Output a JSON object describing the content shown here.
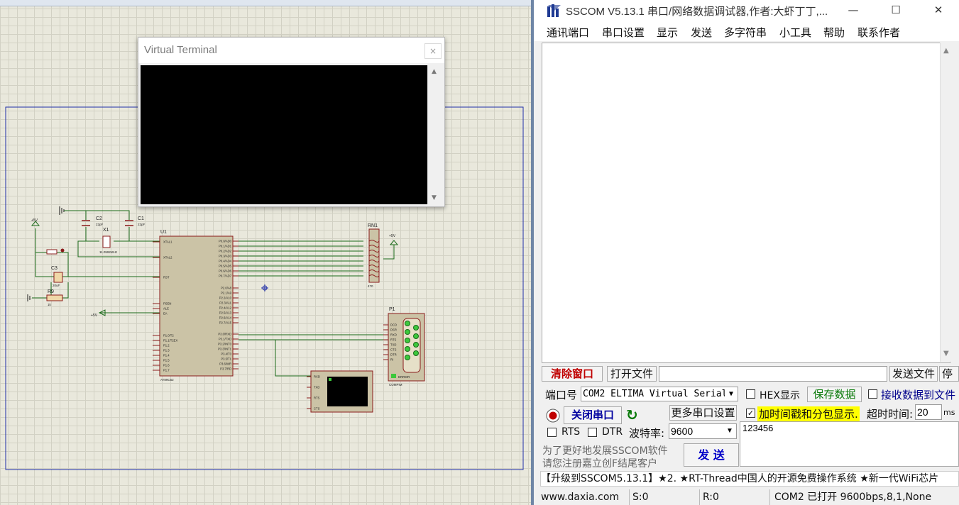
{
  "virtual_terminal": {
    "title": "Virtual Terminal",
    "close": "×"
  },
  "schematic": {
    "components": {
      "c2": "C2",
      "c2_value": "22pF",
      "c1": "C1",
      "c1_value": "22pF",
      "x1": "X1",
      "x1_value": "11.0592MHz",
      "c3": "C3",
      "c3_value": "20uF",
      "r9": "R9",
      "r9_value": "1k",
      "u1": "U1",
      "u1_part": "AT89C52",
      "rn1": "RN1",
      "rn1_value": "470",
      "p1": "P1",
      "p1_part": "COMPIM",
      "p1_error": "ERROR",
      "vcc": "+5V"
    },
    "u1_pins_left": [
      "XTAL1",
      "XTAL2",
      "RST",
      "PSEN",
      "ALE",
      "EA",
      "P1.0/T2",
      "P1.1/T2EX",
      "P1.2",
      "P1.3",
      "P1.4",
      "P1.5",
      "P1.6",
      "P1.7"
    ],
    "u1_pins_right": [
      "P0.0/AD0",
      "P0.1/AD1",
      "P0.2/AD2",
      "P0.3/AD3",
      "P0.4/AD4",
      "P0.5/AD5",
      "P0.6/AD6",
      "P0.7/AD7",
      "P2.0/A8",
      "P2.1/A9",
      "P2.2/A10",
      "P2.3/A11",
      "P2.4/A12",
      "P2.5/A13",
      "P2.6/A14",
      "P2.7/A15",
      "P3.0/RXD",
      "P3.1/TXD",
      "P3.2/INT0",
      "P3.3/INT1",
      "P3.4/T0",
      "P3.5/T1",
      "P3.6/WR",
      "P3.7/RD"
    ],
    "p1_pins": [
      "DCD",
      "DSR",
      "RXD",
      "RTS",
      "TXD",
      "CTS",
      "DTR",
      "RI"
    ],
    "vt_pins": [
      "RXD",
      "TXD",
      "RTS",
      "CTS"
    ]
  },
  "sscom": {
    "title": "SSCOM V5.13.1 串口/网络数据调试器,作者:大虾丁丁,...",
    "window_buttons": {
      "minimize": "—",
      "maximize": "☐",
      "close": "✕"
    },
    "menu": [
      "通讯端口",
      "串口设置",
      "显示",
      "发送",
      "多字符串",
      "小工具",
      "帮助",
      "联系作者"
    ],
    "clear_window": "清除窗口",
    "open_file": "打开文件",
    "send_file": "发送文件",
    "stop": "停",
    "port_label": "端口号",
    "port_value": "COM2 ELTIMA Virtual Serial",
    "hex_display": "HEX显示",
    "save_data": "保存数据",
    "recv_to_file": "接收数据到文件",
    "close_port": "关闭串口",
    "more_settings": "更多串口设置",
    "timestamp_label": "加时间戳和分包显示.",
    "timeout_label": "超时时间:",
    "timeout_value": "20",
    "timeout_unit": "ms",
    "rts": "RTS",
    "dtr": "DTR",
    "baud_label": "波特率:",
    "baud_value": "9600",
    "send_text": "123456",
    "promo_line1": "为了更好地发展SSCOM软件",
    "promo_line2": "请您注册嘉立创F结尾客户",
    "send_button": "发 送",
    "ticker": "【升级到SSCOM5.13.1】★2. ★RT-Thread中国人的开源免费操作系统 ★新一代WiFi芯片",
    "status": {
      "website": "www.daxia.com",
      "sent": "S:0",
      "received": "R:0",
      "port_status": "COM2 已打开  9600bps,8,1,None"
    },
    "colors": {
      "clear_window": "#c00000",
      "save_data": "#0a7a0a",
      "recv_to_file": "#00008b",
      "close_port": "#0000a0",
      "send": "#0000c8",
      "timestamp_bg": "#ffff00"
    }
  }
}
